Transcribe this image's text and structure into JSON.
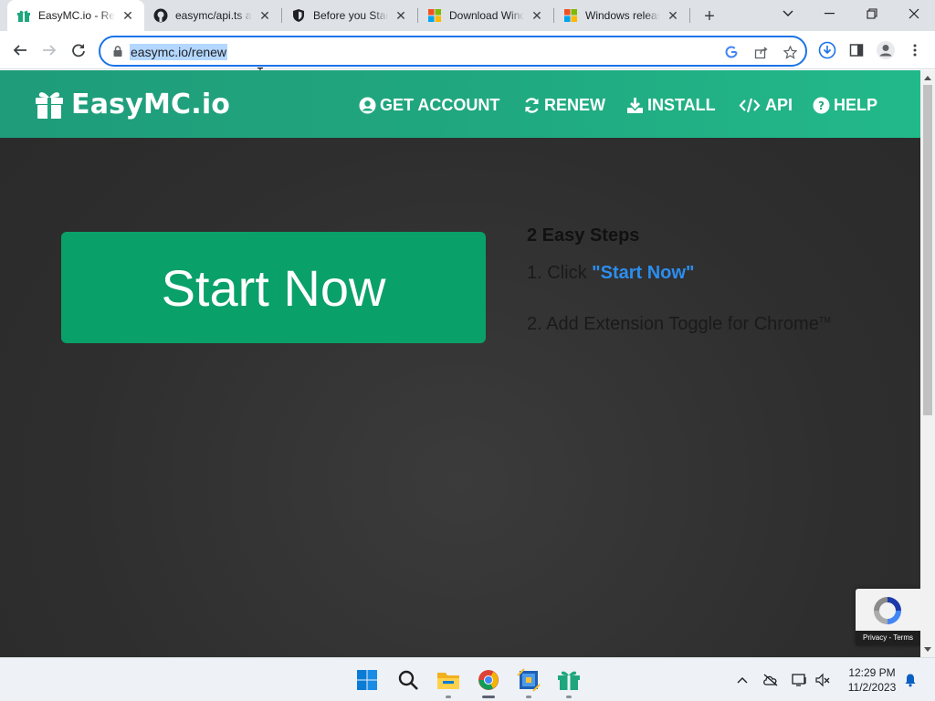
{
  "tabs": [
    {
      "title": "EasyMC.io - Renew",
      "icon": "gift-icon",
      "active": true
    },
    {
      "title": "easymc/api.ts at main",
      "icon": "github-icon",
      "active": false
    },
    {
      "title": "Before you Start",
      "icon": "shield-icon",
      "active": false
    },
    {
      "title": "Download Windows",
      "icon": "windows-logo-icon",
      "active": false
    },
    {
      "title": "Windows release",
      "icon": "windows-logo-icon",
      "active": false
    }
  ],
  "address_bar": {
    "url": "easymc.io/renew",
    "selected": true
  },
  "site": {
    "brand": "EasyMC.io",
    "nav": [
      {
        "label": "GET ACCOUNT",
        "icon": "user-circle-icon"
      },
      {
        "label": "RENEW",
        "icon": "refresh-icon"
      },
      {
        "label": "INSTALL",
        "icon": "download-icon"
      },
      {
        "label": "API",
        "icon": "code-icon"
      },
      {
        "label": "HELP",
        "icon": "question-circle-icon"
      }
    ],
    "start_button": "Start Now",
    "steps_title": "2 Easy Steps",
    "step1_prefix": "1. Click ",
    "step1_link": "\"Start Now\"",
    "step2": "2. Add Extension Toggle for Chrome",
    "step2_tm": "TM",
    "recaptcha_legal": "Privacy - Terms"
  },
  "taskbar": {
    "apps": [
      "windows-start-icon",
      "search-icon",
      "file-explorer-icon",
      "chrome-icon",
      "virtualbox-icon",
      "gift-app-icon"
    ],
    "time": "12:29 PM",
    "date": "11/2/2023"
  },
  "colors": {
    "brand_green": "#1fa67c",
    "start_button": "#0aa06a",
    "link_blue": "#2b8ef0",
    "page_bg": "#2f2f2f"
  }
}
